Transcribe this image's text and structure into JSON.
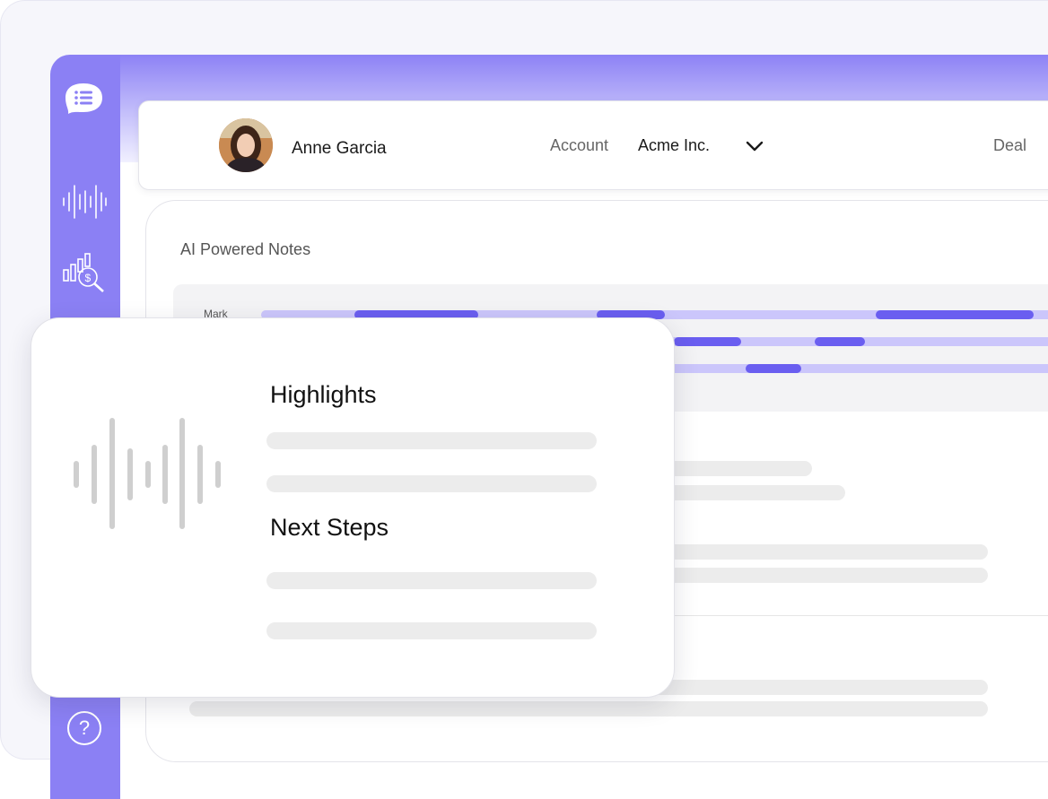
{
  "header": {
    "user_name": "Anne Garcia",
    "account_label": "Account",
    "account_value": "Acme Inc.",
    "deal_label": "Deal"
  },
  "notes": {
    "title": "AI Powered Notes",
    "speaker_label": "Mark"
  },
  "card": {
    "highlights_heading": "Highlights",
    "next_steps_heading": "Next Steps"
  },
  "sidebar": {
    "help_glyph": "?",
    "icons": [
      "logo-icon",
      "audio-wave-icon",
      "analytics-search-icon",
      "help-icon"
    ]
  },
  "colors": {
    "accent": "#8b80f4",
    "segment": "#6a5ef0",
    "track": "#cbc6fb"
  }
}
